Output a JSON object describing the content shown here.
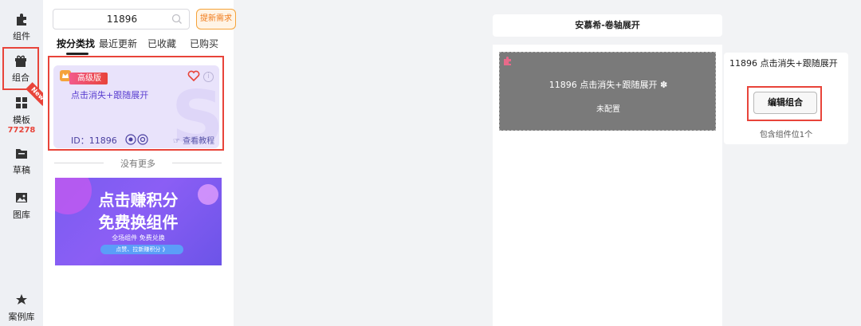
{
  "rail": {
    "items": [
      {
        "label": "组件",
        "icon": "puzzle-icon"
      },
      {
        "label": "组合",
        "icon": "gift-icon",
        "active": true
      },
      {
        "label": "模板",
        "icon": "grid-icon",
        "sub": "77278",
        "ribbon": "New"
      },
      {
        "label": "草稿",
        "icon": "folder-icon"
      },
      {
        "label": "图库",
        "icon": "image-icon"
      },
      {
        "label": "案例库",
        "icon": "star-icon"
      }
    ]
  },
  "panel": {
    "search_value": "11896",
    "request_button": "提新需求",
    "tabs": [
      "按分类找",
      "最近更新",
      "已收藏",
      "已购买"
    ],
    "active_tab": 0,
    "card": {
      "badge": "高级版",
      "title": "点击消失+跟随展开",
      "id_text": "ID：11896",
      "tutorial": "查看教程",
      "bg_letter": "S"
    },
    "no_more": "没有更多",
    "banner": {
      "line1": "点击赚积分",
      "line2": "免费换组件",
      "line3": "全场组件 免费兑换",
      "pill": "点赞、拉新赚积分 》"
    }
  },
  "canvas": {
    "title": "安慕希-卷轴展开",
    "block_title": "11896 点击消失+跟随展开",
    "block_status": "未配置"
  },
  "side": {
    "title": "11896 点击消失+跟随展开",
    "edit_button": "编辑组合",
    "count_text": "包含组件位1个"
  },
  "colors": {
    "highlight": "#e8443a",
    "card_bg": "#e9e3fb",
    "banner": "#7a5cf0",
    "grey_block": "#7a7a7a"
  }
}
